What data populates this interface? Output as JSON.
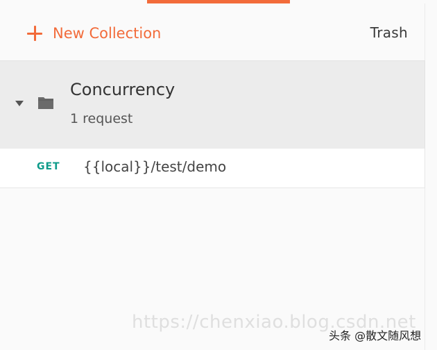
{
  "toolbar": {
    "new_collection_label": "New Collection",
    "trash_label": "Trash"
  },
  "collection": {
    "name": "Concurrency",
    "request_count": "1 request"
  },
  "request": {
    "method": "GET",
    "url": "{{local}}/test/demo"
  },
  "watermark": "https://chenxiao.blog.csdn.net",
  "attribution": "头条 @散文随风想",
  "colors": {
    "accent": "#f26b3a",
    "method_get": "#0e9b8a",
    "collection_bg": "#ececec"
  }
}
